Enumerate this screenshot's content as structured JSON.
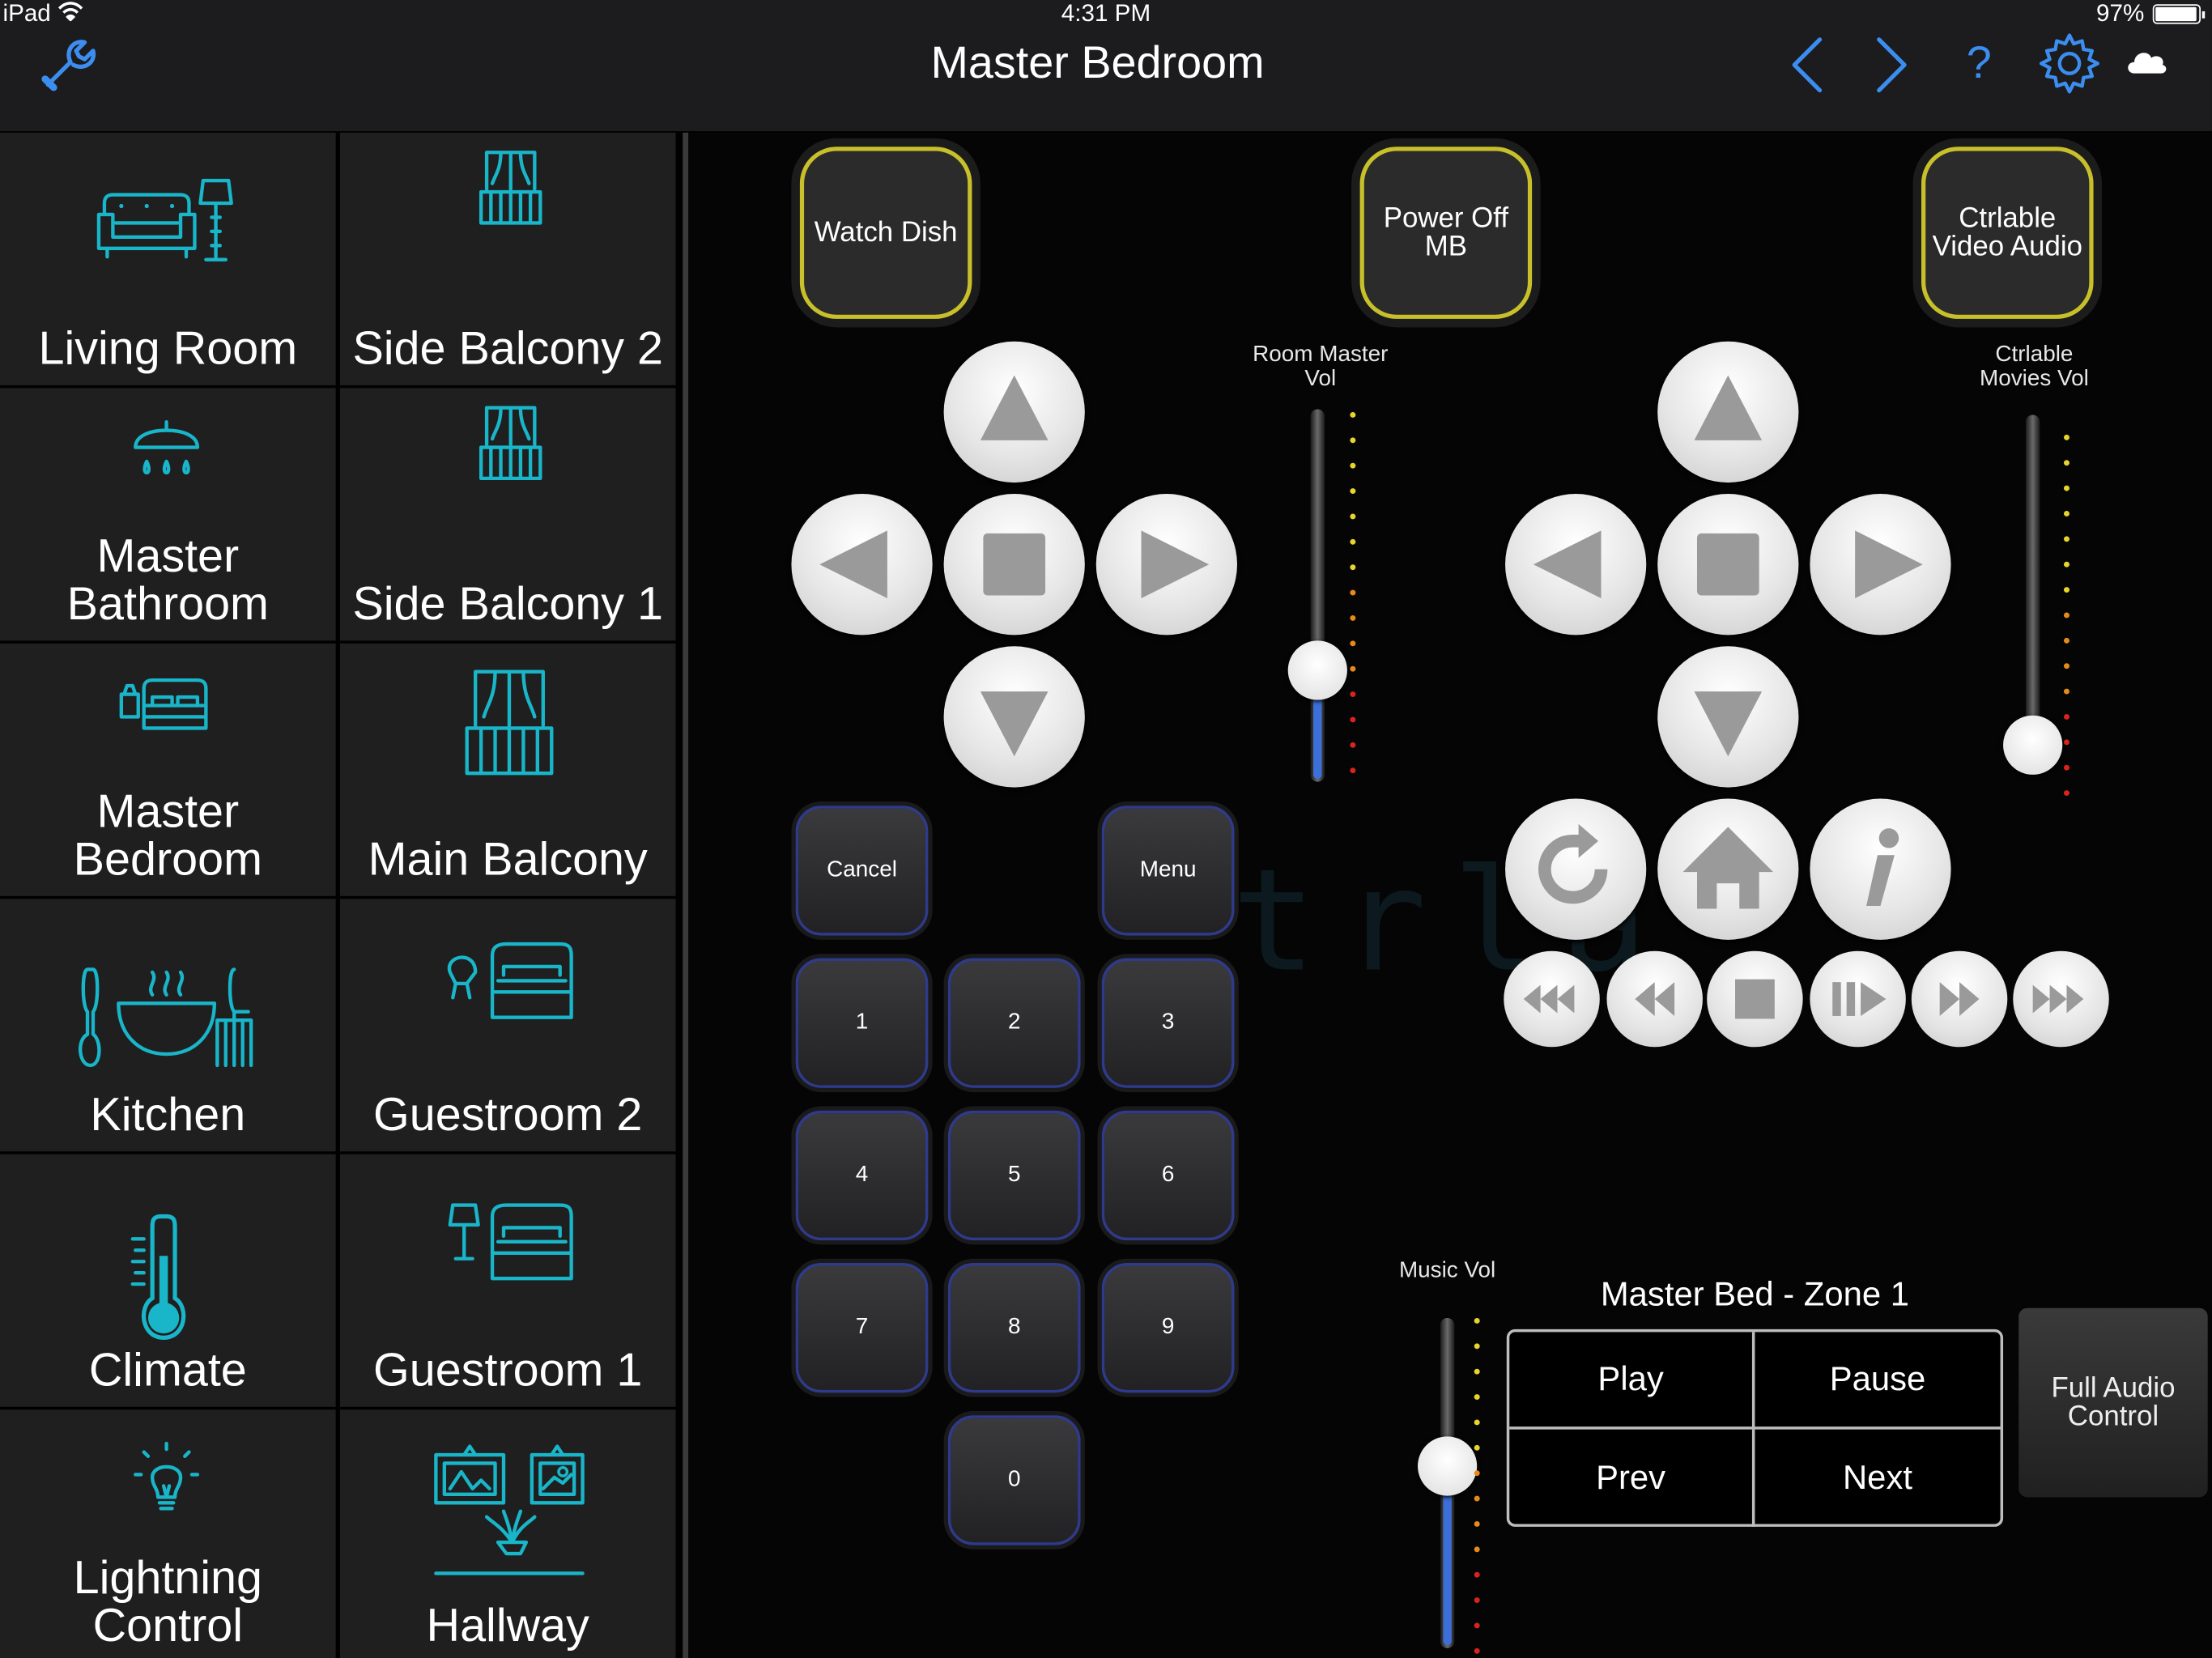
{
  "status": {
    "device": "iPad",
    "time": "4:31 PM",
    "battery": "97%"
  },
  "nav": {
    "title": "Master Bedroom",
    "help": "?"
  },
  "rooms": [
    {
      "label": "Living Room",
      "icon": "sofa-lamp-icon"
    },
    {
      "label": "Side Balcony 2",
      "icon": "balcony-icon"
    },
    {
      "label": "Master Bathroom",
      "icon": "shower-icon"
    },
    {
      "label": "Side Balcony 1",
      "icon": "balcony-icon"
    },
    {
      "label": "Master Bedroom",
      "icon": "bed-icon"
    },
    {
      "label": "Main Balcony",
      "icon": "balcony-icon"
    },
    {
      "label": "Kitchen",
      "icon": "kitchen-icon"
    },
    {
      "label": "Guestroom 2",
      "icon": "guest-bed-icon"
    },
    {
      "label": "Climate",
      "icon": "thermometer-icon"
    },
    {
      "label": "Guestroom 1",
      "icon": "guest-bed-icon"
    },
    {
      "label": "Lightning Control",
      "icon": "lightbulb-icon"
    },
    {
      "label": "Hallway",
      "icon": "hallway-icon"
    }
  ],
  "macros": {
    "watch": "Watch Dish",
    "power_off": "Power Off MB",
    "ctrl": "Ctrlable Video Audio"
  },
  "sliders": {
    "room_master": {
      "label": "Room Master Vol",
      "level": 0.3
    },
    "ctrl_movies": {
      "label": "Ctrlable Movies Vol",
      "level": 0.08
    },
    "music": {
      "label": "Music Vol",
      "level": 0.55
    }
  },
  "keypad": {
    "cancel": "Cancel",
    "menu": "Menu",
    "keys": [
      "1",
      "2",
      "3",
      "4",
      "5",
      "6",
      "7",
      "8",
      "9",
      "0"
    ]
  },
  "zone": {
    "title": "Master Bed - Zone 1",
    "play": "Play",
    "pause": "Pause",
    "prev": "Prev",
    "next": "Next",
    "full_audio": "Full Audio Control"
  },
  "watermark": "trla",
  "colors": {
    "accent": "#3b8ef0",
    "icon": "#19b5c8",
    "macro_border": "#c8c02a",
    "key_border": "#2f3a8a"
  }
}
